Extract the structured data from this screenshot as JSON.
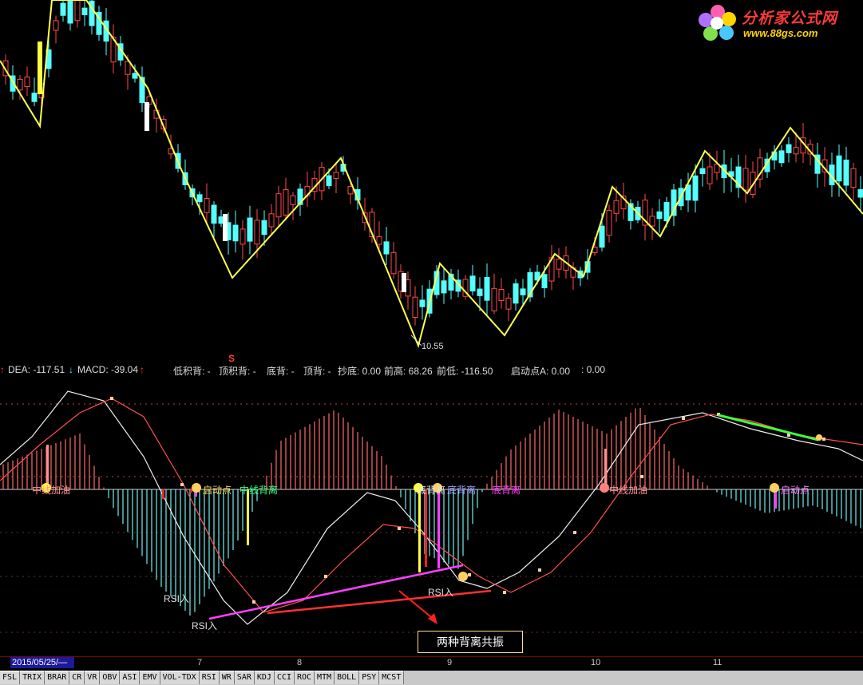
{
  "logo": {
    "brand": "分析家公式网",
    "url": "www.88gs.com",
    "icon": "flower-icon"
  },
  "price_panel": {
    "low_marker": "10.55"
  },
  "indicator_bar": {
    "items": [
      {
        "key": "dea",
        "text": "DEA: -117.51",
        "color": "#ff4040"
      },
      {
        "key": "macd",
        "text": "MACD: -39.04",
        "color": "#ff40ff"
      },
      {
        "key": "low_acc",
        "text": "低积背: -",
        "color": "#ff40ff"
      },
      {
        "key": "top_acc",
        "text": "顶积背: -",
        "color": "#40ffff"
      },
      {
        "key": "bottom_div",
        "text": "底背: -",
        "color": "#ff4040"
      },
      {
        "key": "top_div",
        "text": "顶背: -",
        "color": "#40ff40"
      },
      {
        "key": "chaodi",
        "text": "抄底: 0.00",
        "color": "#ffffff"
      },
      {
        "key": "qiangao",
        "text": "前高: 68.26",
        "color": "#ffffff"
      },
      {
        "key": "qiandi",
        "text": "前低: -116.50",
        "color": "#ffffff"
      },
      {
        "key": "qidong",
        "text": "启动点A: 0.00",
        "color": "#ffffff"
      },
      {
        "key": "blank",
        "text": ": 0.00",
        "color": "#888888"
      }
    ],
    "up_arrow": "arrow-up-icon",
    "down_arrow": "arrow-down-icon",
    "s_marker": "S"
  },
  "macd_signals": {
    "rsi_in_1": "RSI入",
    "rsi_in_2": "RSI入",
    "rsi_in_3": "RSI入",
    "zhongjia_1": "中线加油",
    "qidong_1": "启动点",
    "zhongli_1": "中线背离",
    "bottom_div_label": "底背离",
    "bottom_div_label2": "底背离",
    "zhongjia_2": "中线加油",
    "qidong_2": "启动点"
  },
  "annotation": "两种背离共振",
  "x_axis": {
    "date": "2015/05/25/—",
    "ticks": [
      "7",
      "8",
      "9",
      "10",
      "11"
    ]
  },
  "tabs": [
    "FSL",
    "TRIX",
    "BRAR",
    "CR",
    "VR",
    "OBV",
    "ASI",
    "EMV",
    "VOL-TDX",
    "RSI",
    "WR",
    "SAR",
    "KDJ",
    "CCI",
    "ROC",
    "MTM",
    "BOLL",
    "PSY",
    "MCST"
  ]
}
